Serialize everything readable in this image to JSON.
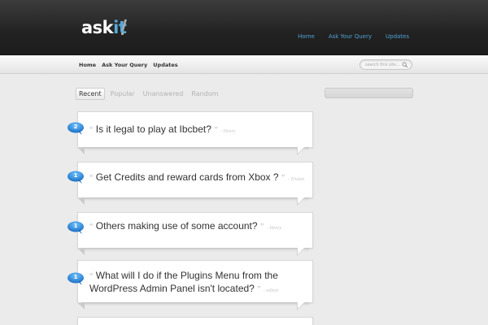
{
  "site": {
    "logo_main": "ask",
    "logo_accent": "it"
  },
  "top_nav": [
    "Home",
    "Ask Your Query",
    "Updates"
  ],
  "sub_nav": [
    "Home",
    "Ask Your Query",
    "Updates"
  ],
  "search": {
    "placeholder": "search this site..."
  },
  "tabs": [
    "Recent",
    "Popular",
    "Unanswered",
    "Random"
  ],
  "questions": [
    {
      "count": "2",
      "line1": "Is it legal to play at Ibcbet?",
      "line2": "",
      "author": "- Henry"
    },
    {
      "count": "1",
      "line1": "Get Credits and reward cards from Xbox ?",
      "line2": "",
      "author": "- Tristan"
    },
    {
      "count": "1",
      "line1": "Others making use of some account?",
      "line2": "",
      "author": "- Henry"
    },
    {
      "count": "1",
      "line1": "What will I do if the Plugins Menu from the",
      "line2": "WordPress Admin Panel isn't located?",
      "author": "- admin"
    }
  ],
  "colors": {
    "accent": "#4fa3d6",
    "badge": "#2f8fe0",
    "header": "#2a2a2a"
  }
}
